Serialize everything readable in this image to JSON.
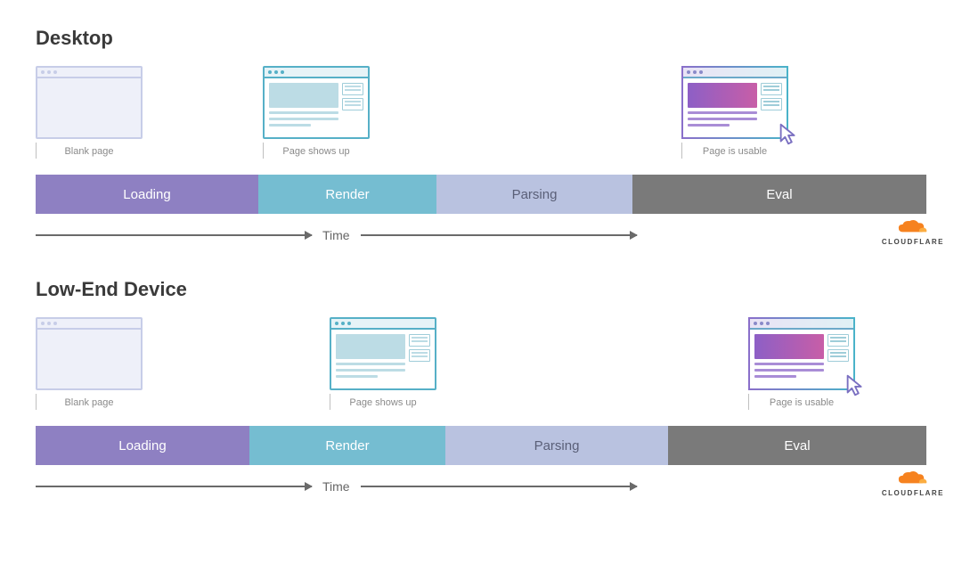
{
  "brand": "CLOUDFLARE",
  "axis_label": "Time",
  "labels": {
    "blank": "Blank page",
    "shows": "Page shows up",
    "usable": "Page is usable"
  },
  "sections": [
    {
      "title": "Desktop",
      "browsers": [
        {
          "kind": "blank",
          "label_key": "blank",
          "left_pct": 0
        },
        {
          "kind": "render",
          "label_key": "shows",
          "left_pct": 25.5
        },
        {
          "kind": "usable",
          "label_key": "usable",
          "left_pct": 72.5,
          "cursor": true
        }
      ],
      "phases": [
        {
          "name": "Loading",
          "class": "loading",
          "width_pct": 25
        },
        {
          "name": "Render",
          "class": "render",
          "width_pct": 20
        },
        {
          "name": "Parsing",
          "class": "parsing",
          "width_pct": 22
        },
        {
          "name": "Eval",
          "class": "eval",
          "width_pct": 33
        }
      ],
      "axis_width_pct": 70
    },
    {
      "title": "Low-End Device",
      "browsers": [
        {
          "kind": "blank",
          "label_key": "blank",
          "left_pct": 0
        },
        {
          "kind": "render",
          "label_key": "shows",
          "left_pct": 33
        },
        {
          "kind": "usable",
          "label_key": "usable",
          "left_pct": 80,
          "cursor": true
        }
      ],
      "phases": [
        {
          "name": "Loading",
          "class": "loading",
          "width_pct": 24
        },
        {
          "name": "Render",
          "class": "render",
          "width_pct": 22
        },
        {
          "name": "Parsing",
          "class": "parsing",
          "width_pct": 25
        },
        {
          "name": "Eval",
          "class": "eval",
          "width_pct": 29
        }
      ],
      "axis_width_pct": 70
    }
  ]
}
